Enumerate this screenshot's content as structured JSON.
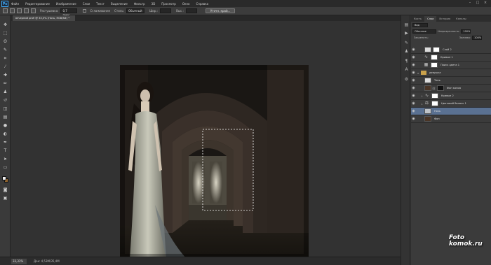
{
  "app": {
    "logo": "Ps"
  },
  "menu": [
    "Файл",
    "Редактирование",
    "Изображение",
    "Слои",
    "Текст",
    "Выделение",
    "Фильтр",
    "3D",
    "Просмотр",
    "Окно",
    "Справка"
  ],
  "options": {
    "feather_label": "Растушевка:",
    "feather_value": "0,7 пикс.",
    "antialias_label": "Сглаживание",
    "style_label": "Стиль:",
    "style_value": "Обычный",
    "width_label": "Шир.:",
    "height_label": "Выс.:",
    "refine_button": "Уточн. край..."
  },
  "document": {
    "tab_title": "вечерний profi @ 33,3% (Ночь, RGB/8#) *"
  },
  "status": {
    "zoom": "33,33%",
    "doc_info": "Док: 4,53М/35,4М"
  },
  "panel": {
    "tabs": [
      "Кисть",
      "Слои",
      "История",
      "Каналы"
    ],
    "active_tab": "Слои",
    "kind_value": "Вид",
    "blend_mode": "Обычные",
    "opacity_label": "Непрозрачность:",
    "opacity_value": "100%",
    "lock_label": "Закрепить:",
    "fill_label": "Заливка:",
    "fill_value": "100%",
    "layers": [
      {
        "name": "Слой 2",
        "type": "normal"
      },
      {
        "name": "Кривые 1",
        "type": "adjustment"
      },
      {
        "name": "Поиск цвета 1",
        "type": "adjustment"
      },
      {
        "name": "девушка",
        "type": "group"
      },
      {
        "name": "Тень",
        "type": "normal"
      },
      {
        "name": "Фон копия",
        "type": "masked"
      },
      {
        "name": "Кривые 2",
        "type": "adjustment"
      },
      {
        "name": "Цветовой баланс 1",
        "type": "adjustment"
      },
      {
        "name": "Ночь",
        "type": "normal",
        "selected": true
      },
      {
        "name": "Фон",
        "type": "normal"
      }
    ]
  },
  "watermark": {
    "line1": "Foto",
    "line2": "komok.ru"
  },
  "colors": {
    "accent_selected": "#5a7192",
    "workspace": "#323232",
    "foreground": "#f2f2f2",
    "background_swatch": "#9a6a30"
  }
}
